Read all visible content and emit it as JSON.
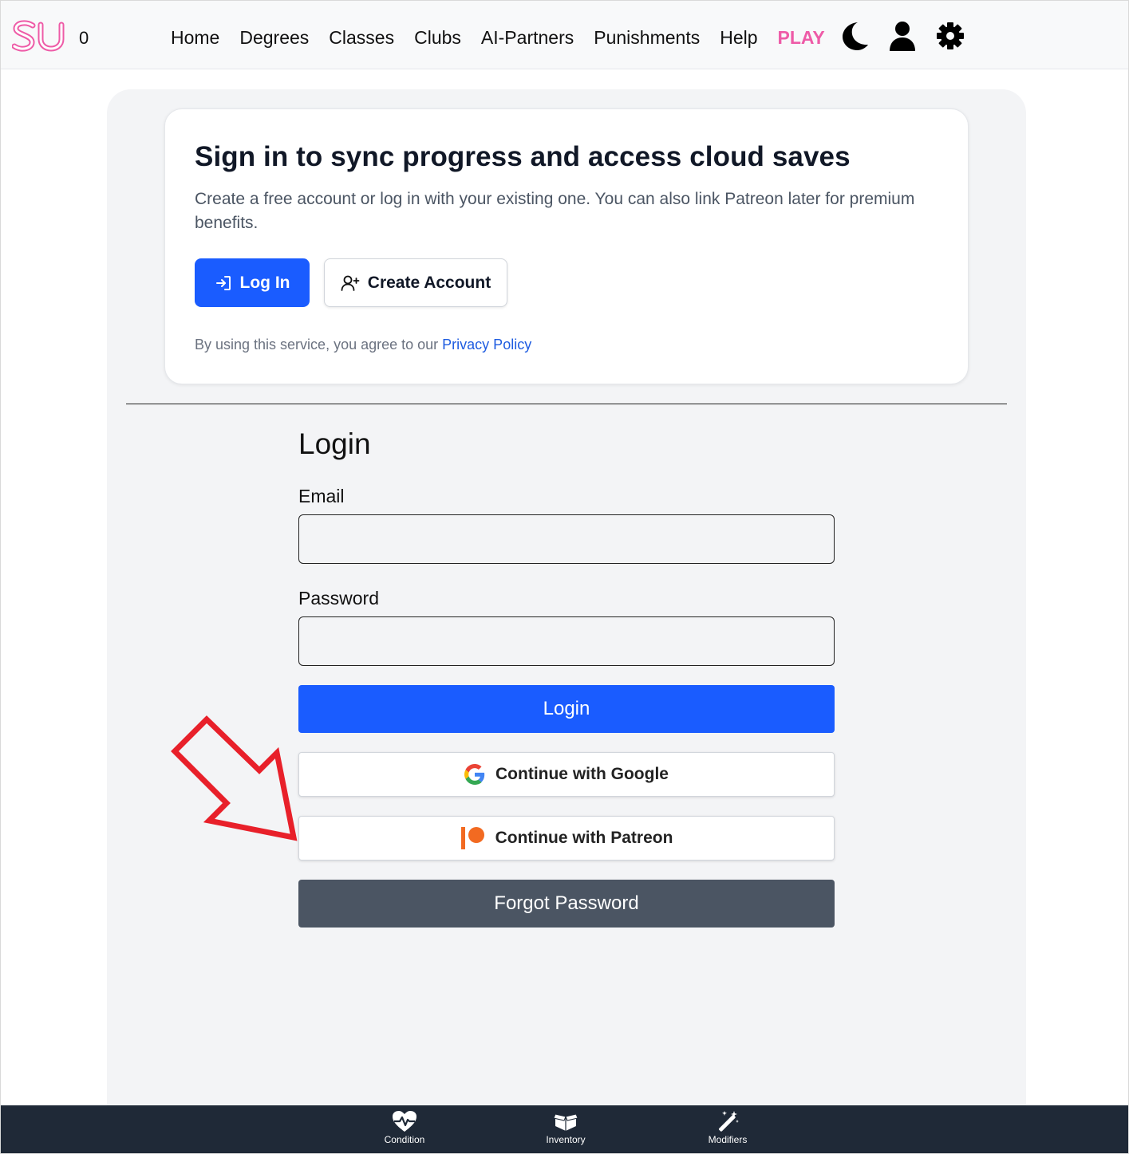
{
  "header": {
    "logo_text": "SU",
    "counter": "0",
    "nav": [
      "Home",
      "Degrees",
      "Classes",
      "Clubs",
      "AI-Partners",
      "Punishments",
      "Help",
      "PLAY"
    ],
    "icons": [
      "moon-icon",
      "user-icon",
      "gear-icon"
    ]
  },
  "signin_card": {
    "title": "Sign in to sync progress and access cloud saves",
    "description": "Create a free account or log in with your existing one. You can also link Patreon later for premium benefits.",
    "login_label": "Log In",
    "create_label": "Create Account",
    "privacy_prefix": "By using this service, you agree to our ",
    "privacy_link": "Privacy Policy"
  },
  "login_form": {
    "heading": "Login",
    "email_label": "Email",
    "email_value": "",
    "password_label": "Password",
    "password_value": "",
    "submit_label": "Login",
    "google_label": "Continue with Google",
    "patreon_label": "Continue with Patreon",
    "forgot_label": "Forgot Password"
  },
  "bottom_nav": [
    {
      "label": "Condition",
      "icon": "heart-pulse-icon"
    },
    {
      "label": "Inventory",
      "icon": "box-icon"
    },
    {
      "label": "Modifiers",
      "icon": "magic-wand-icon"
    }
  ],
  "colors": {
    "brand_pink": "#ee5ba7",
    "primary_blue": "#1a5cff",
    "forgot_gray": "#4b5563",
    "bottom_bar": "#1f2937",
    "annotation_red": "#e8202a"
  }
}
